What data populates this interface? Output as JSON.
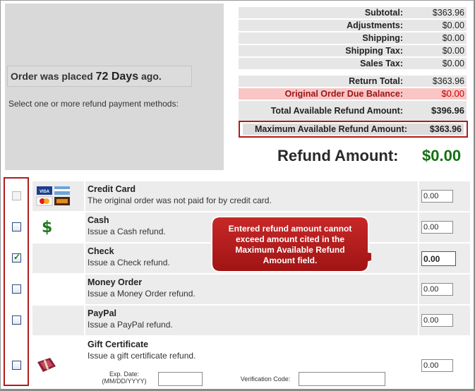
{
  "order": {
    "placed_prefix": "Order was placed",
    "days": "72 Days",
    "placed_suffix": "ago.",
    "instruction": "Select one or more refund payment methods:"
  },
  "totals": [
    {
      "label": "Subtotal:",
      "value": "$363.96"
    },
    {
      "label": "Adjustments:",
      "value": "$0.00"
    },
    {
      "label": "Shipping:",
      "value": "$0.00"
    },
    {
      "label": "Shipping Tax:",
      "value": "$0.00"
    },
    {
      "label": "Sales Tax:",
      "value": "$0.00"
    },
    {
      "label": "Return Total:",
      "value": "$363.96"
    },
    {
      "label": "Original Order Due Balance:",
      "value": "$0.00"
    },
    {
      "label": "Total Available Refund Amount:",
      "value": "$396.96"
    }
  ],
  "max_refund": {
    "label": "Maximum Available Refund Amount:",
    "value": "$363.96"
  },
  "refund_amount": {
    "label": "Refund Amount:",
    "value": "$0.00"
  },
  "methods": [
    {
      "name": "Credit Card",
      "desc": "The original order was not paid for by credit card.",
      "amount": "0.00",
      "checked": false,
      "disabled": true,
      "icon": "credit-cards-icon"
    },
    {
      "name": "Cash",
      "desc": "Issue a Cash refund.",
      "amount": "0.00",
      "checked": false,
      "icon": "dollar-icon",
      "icon_glyph": "$"
    },
    {
      "name": "Check",
      "desc": "Issue a Check refund.",
      "amount": "0.00",
      "checked": true
    },
    {
      "name": "Money Order",
      "desc": "Issue a Money Order refund.",
      "amount": "0.00",
      "checked": false
    },
    {
      "name": "PayPal",
      "desc": "Issue a PayPal refund.",
      "amount": "0.00",
      "checked": false
    },
    {
      "name": "Gift Certificate",
      "desc": "Issue a gift certificate refund.",
      "amount": "0.00",
      "checked": false,
      "icon": "gift-certificate-icon"
    }
  ],
  "gift_fields": {
    "exp_date_label": "Exp. Date:",
    "exp_date_format": "(MM/DD/YYYY)",
    "verification_label": "Verification Code:"
  },
  "callout": {
    "text": "Entered refund amount cannot exceed amount cited in the Maximum Available Refund Amount field."
  },
  "colors": {
    "highlight_border": "#b01c1c",
    "refund_value": "#137013",
    "callout_fill": "#b71c1c"
  }
}
